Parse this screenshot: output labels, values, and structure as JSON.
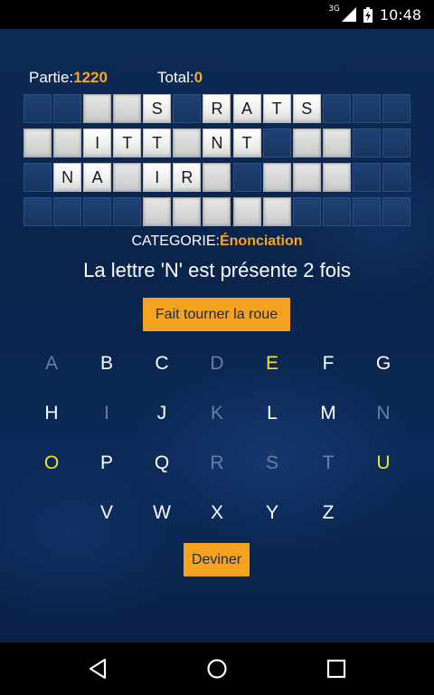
{
  "status_bar": {
    "network": "3G",
    "time": "10:48"
  },
  "score": {
    "partie_label": "Partie:",
    "partie_value": "1220",
    "total_label": "Total:",
    "total_value": "0"
  },
  "board": {
    "rows": [
      [
        "off",
        "off",
        "_",
        "_",
        "S",
        "off",
        "R",
        "A",
        "T",
        "S",
        "off",
        "off",
        "off"
      ],
      [
        "_",
        "_",
        "I",
        "T",
        "T",
        "_",
        "N",
        "T",
        "off",
        "_",
        "_",
        "off",
        "off"
      ],
      [
        "off",
        "N",
        "A",
        "_",
        "I",
        "R",
        "_",
        "off",
        "_",
        "_",
        "_",
        "off",
        "off"
      ],
      [
        "off",
        "off",
        "off",
        "off",
        "_",
        "_",
        "_",
        "_",
        "_",
        "off",
        "off",
        "off",
        "off"
      ]
    ]
  },
  "category": {
    "label": "CATEGORIE:",
    "value": "Énonciation"
  },
  "message": "La lettre 'N' est présente 2 fois",
  "spin_button": "Fait tourner la roue",
  "keyboard": {
    "rows": [
      [
        {
          "l": "A",
          "s": "used"
        },
        {
          "l": "B",
          "s": "free"
        },
        {
          "l": "C",
          "s": "free"
        },
        {
          "l": "D",
          "s": "used"
        },
        {
          "l": "E",
          "s": "vowel"
        },
        {
          "l": "F",
          "s": "free"
        },
        {
          "l": "G",
          "s": "free"
        }
      ],
      [
        {
          "l": "H",
          "s": "free"
        },
        {
          "l": "I",
          "s": "used"
        },
        {
          "l": "J",
          "s": "free"
        },
        {
          "l": "K",
          "s": "used"
        },
        {
          "l": "L",
          "s": "free"
        },
        {
          "l": "M",
          "s": "free"
        },
        {
          "l": "N",
          "s": "used"
        }
      ],
      [
        {
          "l": "O",
          "s": "vowel"
        },
        {
          "l": "P",
          "s": "free"
        },
        {
          "l": "Q",
          "s": "free"
        },
        {
          "l": "R",
          "s": "used"
        },
        {
          "l": "S",
          "s": "used"
        },
        {
          "l": "T",
          "s": "used"
        },
        {
          "l": "U",
          "s": "vowel"
        }
      ],
      [
        {
          "l": "V",
          "s": "free"
        },
        {
          "l": "W",
          "s": "free"
        },
        {
          "l": "X",
          "s": "free"
        },
        {
          "l": "Y",
          "s": "free"
        },
        {
          "l": "Z",
          "s": "free"
        }
      ]
    ]
  },
  "guess_button": "Deviner",
  "nav": {
    "back_icon": "back-triangle-icon",
    "home_icon": "home-circle-icon",
    "recents_icon": "recents-square-icon"
  },
  "colors": {
    "accent": "#f5a623",
    "vowel": "#f2e22c",
    "used": "#6a7ea0",
    "background": "#0c2346"
  }
}
